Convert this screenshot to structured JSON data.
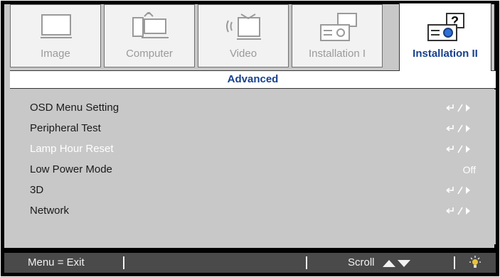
{
  "tabs": [
    {
      "label": "Image",
      "icon": "monitor-icon",
      "active": false
    },
    {
      "label": "Computer",
      "icon": "computer-icon",
      "active": false
    },
    {
      "label": "Video",
      "icon": "video-icon",
      "active": false
    },
    {
      "label": "Installation I",
      "icon": "projector-icon",
      "active": false
    },
    {
      "label": "Installation II",
      "icon": "projector-help-icon",
      "active": true
    }
  ],
  "submenu": {
    "title": "Advanced"
  },
  "menu_items": [
    {
      "label": "OSD Menu Setting",
      "value_icon": "enter-arrow-icon",
      "enabled": true
    },
    {
      "label": "Peripheral Test",
      "value_icon": "enter-arrow-icon",
      "enabled": true
    },
    {
      "label": "Lamp Hour Reset",
      "value_icon": "enter-arrow-icon",
      "enabled": false
    },
    {
      "label": "Low Power Mode",
      "value": "Off",
      "enabled": true
    },
    {
      "label": "3D",
      "value_icon": "enter-arrow-icon",
      "enabled": true
    },
    {
      "label": "Network",
      "value_icon": "enter-arrow-icon",
      "enabled": true
    }
  ],
  "status_bar": {
    "menu_exit": "Menu = Exit",
    "scroll": "Scroll",
    "scroll_icon": "up-down-triangle-icon",
    "lamp_icon": "lamp-icon"
  },
  "colors": {
    "active_tab_text": "#17408f",
    "panel": "#c8c8c8",
    "status_bar": "#4a4a4a"
  }
}
